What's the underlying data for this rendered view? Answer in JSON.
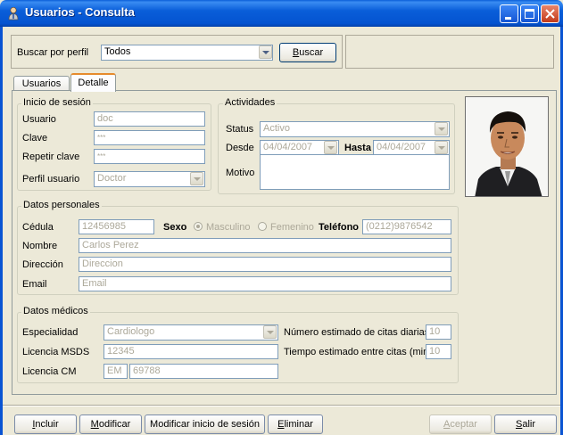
{
  "window": {
    "title": "Usuarios - Consulta"
  },
  "search": {
    "label": "Buscar por perfil",
    "profile_value": "Todos",
    "button_pre": "",
    "button_u": "B",
    "button_post": "uscar"
  },
  "tabs": [
    {
      "label": "Usuarios"
    },
    {
      "label": "Detalle"
    }
  ],
  "login": {
    "legend": "Inicio de sesión",
    "user_label": "Usuario",
    "user_value": "doc",
    "password_label": "Clave",
    "password_value": "***",
    "repeat_label": "Repetir clave",
    "repeat_value": "***",
    "profile_label": "Perfil usuario",
    "profile_value": "Doctor"
  },
  "activities": {
    "legend": "Actividades",
    "status_label": "Status",
    "status_value": "Activo",
    "from_label": "Desde",
    "from_value": "04/04/2007",
    "to_label": "Hasta",
    "to_value": "04/04/2007",
    "reason_label": "Motivo",
    "reason_value": ""
  },
  "personal": {
    "legend": "Datos personales",
    "id_label": "Cédula",
    "id_value": "12456985",
    "sex_label": "Sexo",
    "sex_male": "Masculino",
    "sex_female": "Femenino",
    "sex_selected": "Masculino",
    "phone_label": "Teléfono",
    "phone_value": "(0212)9876542",
    "name_label": "Nombre",
    "name_value": "Carlos Perez",
    "address_label": "Dirección",
    "address_value": "Direccion",
    "email_label": "Email",
    "email_value": "Email"
  },
  "medical": {
    "legend": "Datos médicos",
    "specialty_label": "Especialidad",
    "specialty_value": "Cardiologo",
    "msds_label": "Licencia MSDS",
    "msds_value": "12345",
    "cm_label": "Licencia CM",
    "cm_prefix": "EM",
    "cm_value": "69788",
    "daily_label": "Número estimado de citas diarias",
    "daily_value": "10",
    "interval_label": "Tiempo estimado entre citas (min)",
    "interval_value": "10"
  },
  "footer": {
    "add_pre": "",
    "add_u": "I",
    "add_post": "ncluir",
    "modify_pre": "",
    "modify_u": "M",
    "modify_post": "odificar",
    "modify_login": "Modificar inicio de sesión",
    "delete_pre": "",
    "delete_u": "E",
    "delete_post": "liminar",
    "accept_pre": "",
    "accept_u": "A",
    "accept_post": "ceptar",
    "exit_pre": "",
    "exit_u": "S",
    "exit_post": "alir"
  },
  "colors": {
    "title_bar": "#0a5ed9",
    "face": "#ece9d8",
    "disabled_text": "#aca899",
    "input_border": "#7f9db9"
  }
}
